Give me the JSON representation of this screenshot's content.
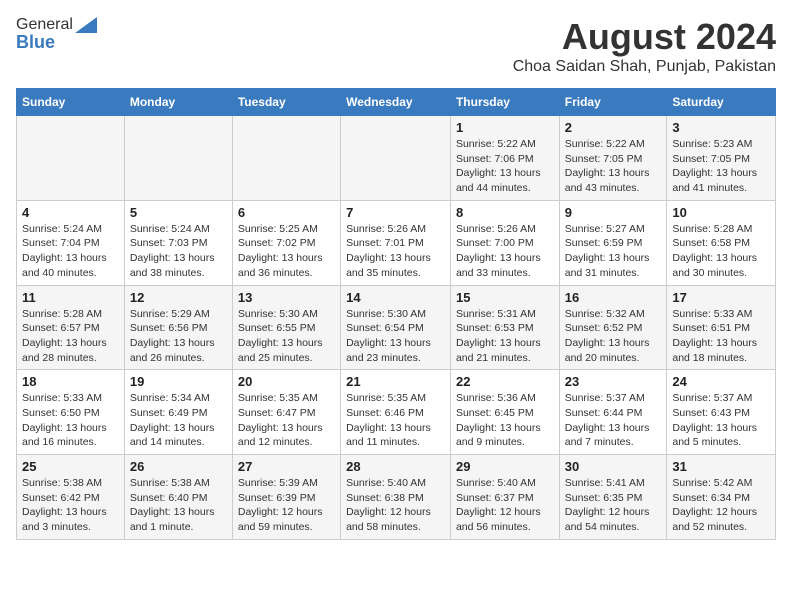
{
  "header": {
    "logo_general": "General",
    "logo_blue": "Blue",
    "month": "August 2024",
    "location": "Choa Saidan Shah, Punjab, Pakistan"
  },
  "weekdays": [
    "Sunday",
    "Monday",
    "Tuesday",
    "Wednesday",
    "Thursday",
    "Friday",
    "Saturday"
  ],
  "weeks": [
    [
      {
        "day": "",
        "info": ""
      },
      {
        "day": "",
        "info": ""
      },
      {
        "day": "",
        "info": ""
      },
      {
        "day": "",
        "info": ""
      },
      {
        "day": "1",
        "info": "Sunrise: 5:22 AM\nSunset: 7:06 PM\nDaylight: 13 hours\nand 44 minutes."
      },
      {
        "day": "2",
        "info": "Sunrise: 5:22 AM\nSunset: 7:05 PM\nDaylight: 13 hours\nand 43 minutes."
      },
      {
        "day": "3",
        "info": "Sunrise: 5:23 AM\nSunset: 7:05 PM\nDaylight: 13 hours\nand 41 minutes."
      }
    ],
    [
      {
        "day": "4",
        "info": "Sunrise: 5:24 AM\nSunset: 7:04 PM\nDaylight: 13 hours\nand 40 minutes."
      },
      {
        "day": "5",
        "info": "Sunrise: 5:24 AM\nSunset: 7:03 PM\nDaylight: 13 hours\nand 38 minutes."
      },
      {
        "day": "6",
        "info": "Sunrise: 5:25 AM\nSunset: 7:02 PM\nDaylight: 13 hours\nand 36 minutes."
      },
      {
        "day": "7",
        "info": "Sunrise: 5:26 AM\nSunset: 7:01 PM\nDaylight: 13 hours\nand 35 minutes."
      },
      {
        "day": "8",
        "info": "Sunrise: 5:26 AM\nSunset: 7:00 PM\nDaylight: 13 hours\nand 33 minutes."
      },
      {
        "day": "9",
        "info": "Sunrise: 5:27 AM\nSunset: 6:59 PM\nDaylight: 13 hours\nand 31 minutes."
      },
      {
        "day": "10",
        "info": "Sunrise: 5:28 AM\nSunset: 6:58 PM\nDaylight: 13 hours\nand 30 minutes."
      }
    ],
    [
      {
        "day": "11",
        "info": "Sunrise: 5:28 AM\nSunset: 6:57 PM\nDaylight: 13 hours\nand 28 minutes."
      },
      {
        "day": "12",
        "info": "Sunrise: 5:29 AM\nSunset: 6:56 PM\nDaylight: 13 hours\nand 26 minutes."
      },
      {
        "day": "13",
        "info": "Sunrise: 5:30 AM\nSunset: 6:55 PM\nDaylight: 13 hours\nand 25 minutes."
      },
      {
        "day": "14",
        "info": "Sunrise: 5:30 AM\nSunset: 6:54 PM\nDaylight: 13 hours\nand 23 minutes."
      },
      {
        "day": "15",
        "info": "Sunrise: 5:31 AM\nSunset: 6:53 PM\nDaylight: 13 hours\nand 21 minutes."
      },
      {
        "day": "16",
        "info": "Sunrise: 5:32 AM\nSunset: 6:52 PM\nDaylight: 13 hours\nand 20 minutes."
      },
      {
        "day": "17",
        "info": "Sunrise: 5:33 AM\nSunset: 6:51 PM\nDaylight: 13 hours\nand 18 minutes."
      }
    ],
    [
      {
        "day": "18",
        "info": "Sunrise: 5:33 AM\nSunset: 6:50 PM\nDaylight: 13 hours\nand 16 minutes."
      },
      {
        "day": "19",
        "info": "Sunrise: 5:34 AM\nSunset: 6:49 PM\nDaylight: 13 hours\nand 14 minutes."
      },
      {
        "day": "20",
        "info": "Sunrise: 5:35 AM\nSunset: 6:47 PM\nDaylight: 13 hours\nand 12 minutes."
      },
      {
        "day": "21",
        "info": "Sunrise: 5:35 AM\nSunset: 6:46 PM\nDaylight: 13 hours\nand 11 minutes."
      },
      {
        "day": "22",
        "info": "Sunrise: 5:36 AM\nSunset: 6:45 PM\nDaylight: 13 hours\nand 9 minutes."
      },
      {
        "day": "23",
        "info": "Sunrise: 5:37 AM\nSunset: 6:44 PM\nDaylight: 13 hours\nand 7 minutes."
      },
      {
        "day": "24",
        "info": "Sunrise: 5:37 AM\nSunset: 6:43 PM\nDaylight: 13 hours\nand 5 minutes."
      }
    ],
    [
      {
        "day": "25",
        "info": "Sunrise: 5:38 AM\nSunset: 6:42 PM\nDaylight: 13 hours\nand 3 minutes."
      },
      {
        "day": "26",
        "info": "Sunrise: 5:38 AM\nSunset: 6:40 PM\nDaylight: 13 hours\nand 1 minute."
      },
      {
        "day": "27",
        "info": "Sunrise: 5:39 AM\nSunset: 6:39 PM\nDaylight: 12 hours\nand 59 minutes."
      },
      {
        "day": "28",
        "info": "Sunrise: 5:40 AM\nSunset: 6:38 PM\nDaylight: 12 hours\nand 58 minutes."
      },
      {
        "day": "29",
        "info": "Sunrise: 5:40 AM\nSunset: 6:37 PM\nDaylight: 12 hours\nand 56 minutes."
      },
      {
        "day": "30",
        "info": "Sunrise: 5:41 AM\nSunset: 6:35 PM\nDaylight: 12 hours\nand 54 minutes."
      },
      {
        "day": "31",
        "info": "Sunrise: 5:42 AM\nSunset: 6:34 PM\nDaylight: 12 hours\nand 52 minutes."
      }
    ]
  ]
}
